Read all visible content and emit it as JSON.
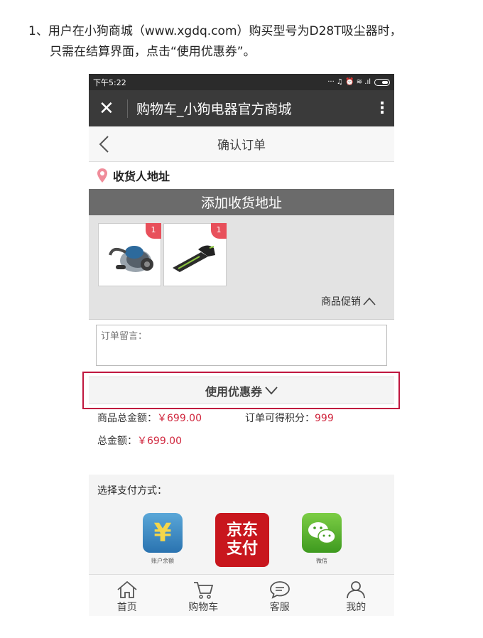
{
  "instruction": {
    "line1": "1、用户在小狗商城（www.xgdq.com）购买型号为D28T吸尘器时，",
    "line2": "只需在结算界面，点击“使用优惠券”。"
  },
  "status_bar": {
    "time": "下午5:22",
    "icons": "··· ♫ ⏰ ≋ .ıl"
  },
  "app_bar": {
    "close_symbol": "✕",
    "title": "购物车_小狗电器官方商城",
    "more_symbol": "⋮"
  },
  "page": {
    "title": "确认订单"
  },
  "address": {
    "label": "收货人地址",
    "add_button": "添加收货地址"
  },
  "products": {
    "items": [
      {
        "name": "canister-vacuum",
        "qty": "1"
      },
      {
        "name": "handheld-vacuum",
        "qty": "1"
      }
    ],
    "promo_label": "商品促销"
  },
  "message": {
    "placeholder": "订单留言："
  },
  "coupon": {
    "label": "使用优惠券",
    "highlight_color": "#c0173f"
  },
  "totals": {
    "goods_total_label": "商品总金额：",
    "goods_total_value": "￥699.00",
    "points_label": "订单可得积分：",
    "points_value": "999",
    "grand_total_label": "总金额：",
    "grand_total_value": "￥699.00"
  },
  "payment": {
    "label": "选择支付方式：",
    "options": [
      {
        "icon": "yen-icon",
        "glyph": "¥",
        "caption": "账户余额"
      },
      {
        "icon": "jd-pay-icon",
        "line1": "京东",
        "line2": "支付",
        "caption": ""
      },
      {
        "icon": "wechat-icon",
        "caption": "微信"
      }
    ]
  },
  "tabs": [
    {
      "label": "首页",
      "icon": "home-icon"
    },
    {
      "label": "购物车",
      "icon": "cart-icon"
    },
    {
      "label": "客服",
      "icon": "chat-icon"
    },
    {
      "label": "我的",
      "icon": "user-icon"
    }
  ]
}
